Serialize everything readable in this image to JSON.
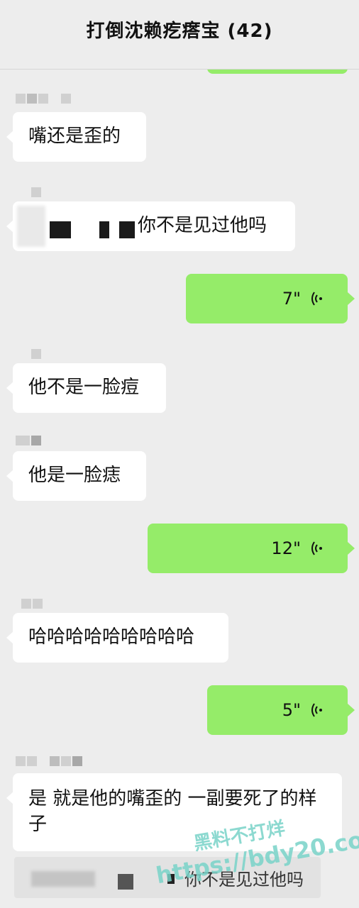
{
  "header": {
    "title": "打倒沈赖疙瘩宝 (42)"
  },
  "messages": {
    "m1": "嘴还是歪的",
    "m2": "你不是见过他吗",
    "m3_duration": "7\"",
    "m4": "他不是一脸痘",
    "m5": "他是一脸痣",
    "m6_duration": "12\"",
    "m7": "哈哈哈哈哈哈哈哈哈",
    "m8_duration": "5\"",
    "m9": "是 就是他的嘴歪的 一副要死了的样子"
  },
  "quote": {
    "text": "你不是见过他吗"
  },
  "watermark": {
    "line1": "黑料不打烊",
    "line2": "https://bdy20.co"
  },
  "colors": {
    "background": "#ededed",
    "outgoing": "#95ec69",
    "incoming": "#ffffff",
    "watermark": "#78d2c8"
  },
  "icons": {
    "voice": "voice-wave-icon"
  }
}
